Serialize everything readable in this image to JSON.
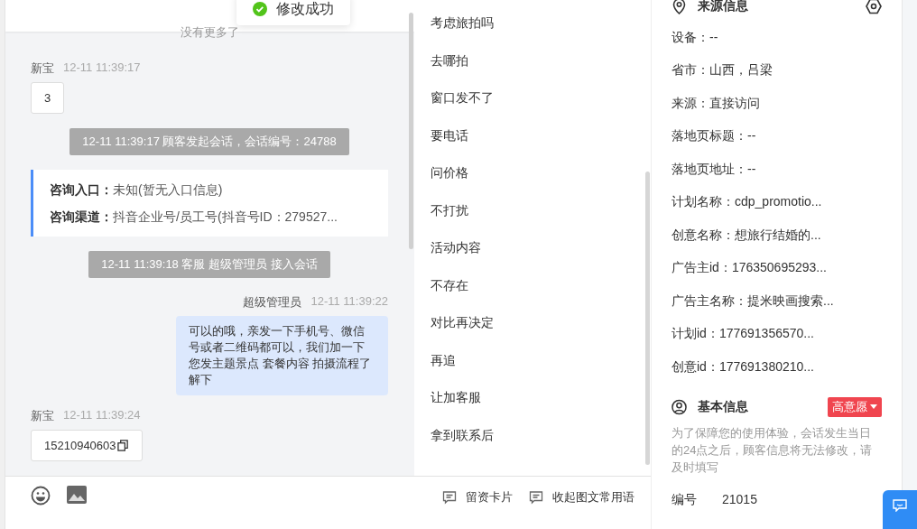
{
  "toast": {
    "text": "修改成功"
  },
  "chat": {
    "end_notice": "没有更多了",
    "items": [
      {
        "kind": "incoming",
        "sender": "新宝",
        "time": "12-11 11:39:17",
        "text": "3",
        "copyable": false
      },
      {
        "kind": "system",
        "text": "12-11 11:39:17 顾客发起会话，会话编号：24788"
      },
      {
        "kind": "entry",
        "lines": [
          {
            "label": "咨询入口：",
            "value": "未知(暂无入口信息)"
          },
          {
            "label": "咨询渠道：",
            "value": "抖音企业号/员工号(抖音号ID：279527..."
          }
        ]
      },
      {
        "kind": "system",
        "text": "12-11 11:39:18 客服 超级管理员 接入会话"
      },
      {
        "kind": "outgoing",
        "sender": "超级管理员",
        "time": "12-11 11:39:22",
        "text": "可以的哦，亲发一下手机号、微信号或者二维码都可以，我们加一下您发主题景点 套餐内容 拍摄流程了解下"
      },
      {
        "kind": "incoming",
        "sender": "新宝",
        "time": "12-11 11:39:24",
        "text": "15210940603",
        "copyable": true
      }
    ]
  },
  "phrases": [
    "考虑旅拍吗",
    "去哪拍",
    "窗口发不了",
    "要电话",
    "问价格",
    "不打扰",
    "活动内容",
    "不存在",
    "对比再决定",
    "再追",
    "让加客服",
    "拿到联系后"
  ],
  "toolbar": {
    "actions": [
      "留资卡片",
      "收起图文常用语"
    ]
  },
  "info": {
    "source": {
      "title": "来源信息",
      "rows": [
        "设备：--",
        "省市：山西，吕梁",
        "来源：直接访问",
        "落地页标题：--",
        "落地页地址：--",
        "计划名称：cdp_promotio...",
        "创意名称：想旅行结婚的...",
        "广告主id：176350695293...",
        "广告主名称：提米映画搜索...",
        "计划id：177691356570...",
        "创意id：177691380210..."
      ]
    },
    "basic": {
      "title": "基本信息",
      "badge": "高意愿",
      "note": "为了保障您的使用体验，会话发生当日的24点之后，顾客信息将无法修改，请及时填写",
      "fields": [
        {
          "label": "编号",
          "value": "21015"
        }
      ]
    }
  }
}
